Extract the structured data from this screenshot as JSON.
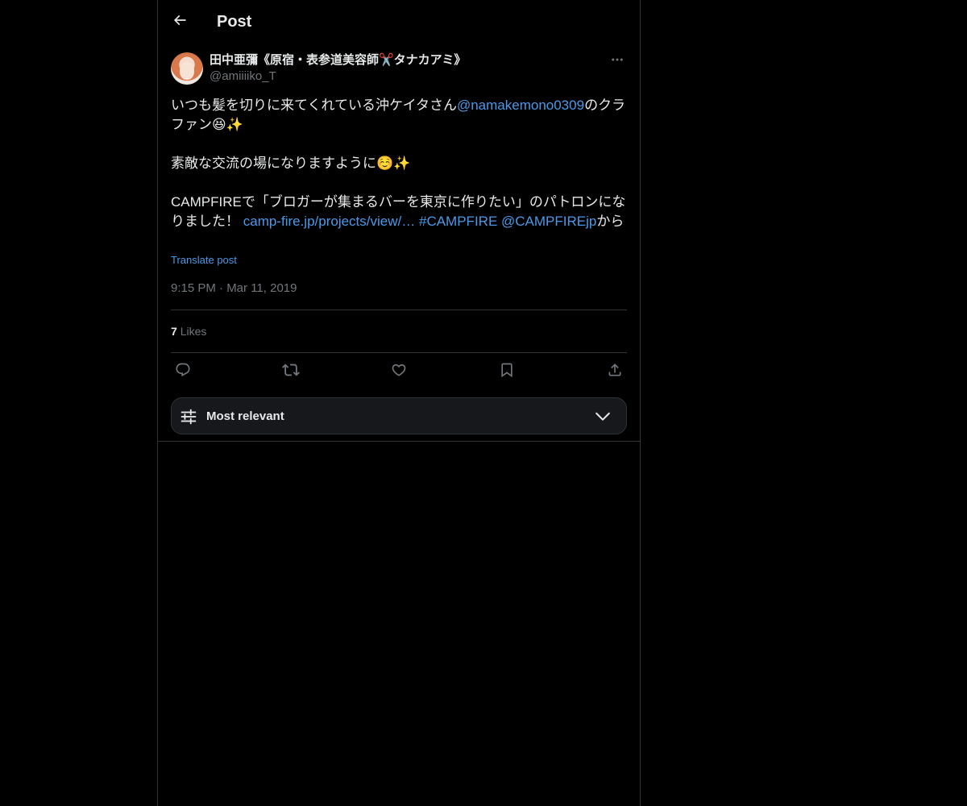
{
  "header": {
    "back_icon": "arrow-left-icon",
    "title": "Post"
  },
  "post": {
    "author": {
      "display_name": "田中亜彌《原宿・表参道美容師✂️タナカアミ》",
      "handle": "@amiiiiko_T",
      "avatar": "avatar-photo"
    },
    "text": {
      "line1_pre": "いつも髪を切りに来てくれている沖ケイタさん",
      "mention1": "@namakemono0309",
      "line1_post": "のクラファン",
      "line1_emoji": "😆✨",
      "line2": "素敵な交流の場になりますように",
      "line2_emoji": "☺️✨",
      "line3_pre": "CAMPFIREで「ブロガーが集まるバーを東京に作りたい」のパトロンになりました！ ",
      "link": "camp-fire.jp/projects/view/…",
      "hashtag": "#CAMPFIRE",
      "mention2": "@CAMPFIREjp",
      "line3_post": "から"
    },
    "translate_label": "Translate post",
    "timestamp": "9:15 PM · Mar 11, 2019",
    "likes_count": "7",
    "likes_label": "Likes",
    "actions": [
      "reply-icon",
      "repost-icon",
      "like-icon",
      "bookmark-icon",
      "share-icon"
    ]
  },
  "sort": {
    "label": "Most relevant",
    "icon": "sliders-icon",
    "chevron": "chevron-down-icon"
  },
  "colors": {
    "background": "#000000",
    "text": "#e7e9ea",
    "secondary": "#71767b",
    "link": "#4a99e9",
    "border": "#2f3336"
  }
}
